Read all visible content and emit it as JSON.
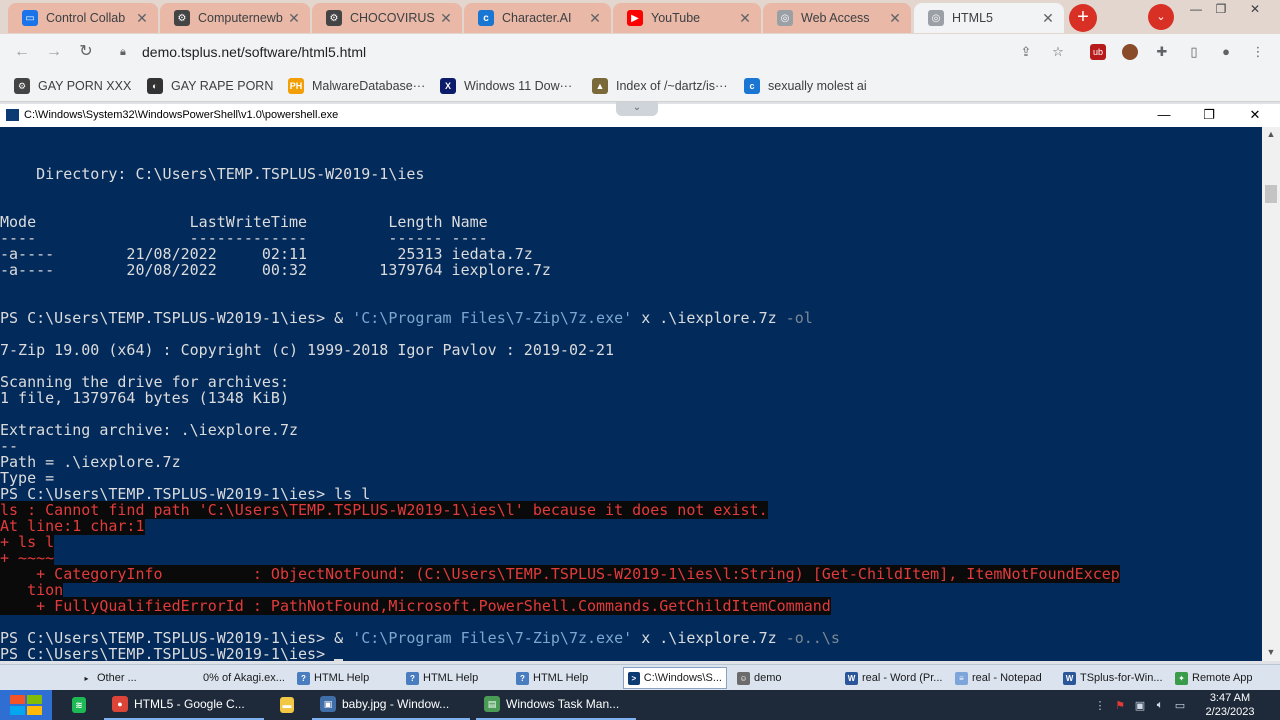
{
  "browser": {
    "tabs": [
      {
        "title": "Control Collab",
        "favicon": "monitor-icon",
        "color": "#1a73e8",
        "active": false
      },
      {
        "title": "Computernewb",
        "favicon": "gear-icon",
        "color": "#444444",
        "active": false
      },
      {
        "title": "CHOCOVIRUS",
        "favicon": "gear-icon",
        "color": "#444444",
        "active": false
      },
      {
        "title": "Character.AI",
        "favicon": "chat-icon",
        "color": "#1976d2",
        "active": false
      },
      {
        "title": "YouTube",
        "favicon": "play-icon",
        "color": "#ff0000",
        "active": false
      },
      {
        "title": "Web Access",
        "favicon": "globe-icon",
        "color": "#9aa0a6",
        "active": false
      },
      {
        "title": "HTML5",
        "favicon": "globe-icon",
        "color": "#9aa0a6",
        "active": true
      }
    ],
    "new_tab_label": "+",
    "tab_search_label": "⌄",
    "url": "demo.tsplus.net/software/html5.html",
    "bookmarks": [
      {
        "label": "GAY PORN XXX",
        "icon": "gear-icon",
        "color": "#444444",
        "glyph": "⚙"
      },
      {
        "label": "GAY RAPE PORN",
        "icon": "disc-icon",
        "color": "#333333",
        "glyph": "◐"
      },
      {
        "label": "MalwareDatabase···",
        "icon": "ph-icon",
        "color": "#f29f05",
        "glyph": "PH"
      },
      {
        "label": "Windows 11 Dow···",
        "icon": "x-icon",
        "color": "#0d1b6b",
        "glyph": "X"
      },
      {
        "label": "Index of /~dartz/is···",
        "icon": "folder-icon",
        "color": "#7a6a3a",
        "glyph": "▲"
      },
      {
        "label": "sexually molest ai",
        "icon": "chat-icon",
        "color": "#1976d2",
        "glyph": "c"
      }
    ]
  },
  "powershell": {
    "title": "C:\\Windows\\System32\\WindowsPowerShell\\v1.0\\powershell.exe",
    "lines": [
      [
        {
          "t": "    Directory: C:\\Users\\TEMP.TSPLUS-W2019-1\\ies"
        }
      ],
      [
        {
          "t": "Mode                 LastWriteTime         Length Name"
        }
      ],
      [
        {
          "t": "----                 -------------         ------ ----"
        }
      ],
      [
        {
          "t": "-a----        21/08/2022     02:11          25313 iedata.7z"
        }
      ],
      [
        {
          "t": "-a----        20/08/2022     00:32        1379764 iexplore.7z"
        }
      ],
      [
        {
          "t": "PS C:\\Users\\TEMP.TSPLUS-W2019-1\\ies> & "
        },
        {
          "t": "'C:\\Program Files\\7-Zip\\7z.exe'",
          "c": "str"
        },
        {
          "t": " x .\\iexplore.7z "
        },
        {
          "t": "-ol",
          "c": "param"
        }
      ],
      [
        {
          "t": "7-Zip 19.00 (x64) : Copyright (c) 1999-2018 Igor Pavlov : 2019-02-21"
        }
      ],
      [
        {
          "t": "Scanning the drive for archives:"
        }
      ],
      [
        {
          "t": "1 file, 1379764 bytes (1348 KiB)"
        }
      ],
      [
        {
          "t": "Extracting archive: .\\iexplore.7z"
        }
      ],
      [
        {
          "t": "--"
        }
      ],
      [
        {
          "t": "Path = .\\iexplore.7z"
        }
      ],
      [
        {
          "t": "Type = "
        }
      ],
      [
        {
          "t": "PS C:\\Users\\TEMP.TSPLUS-W2019-1\\ies> ls l"
        }
      ],
      [
        {
          "t": "ls : Cannot find path 'C:\\Users\\TEMP.TSPLUS-W2019-1\\ies\\l' because it does not exist.",
          "c": "err"
        }
      ],
      [
        {
          "t": "At line:1 char:1",
          "c": "err"
        }
      ],
      [
        {
          "t": "+ ls l",
          "c": "err"
        }
      ],
      [
        {
          "t": "+ ~~~~",
          "c": "err"
        }
      ],
      [
        {
          "t": "    + CategoryInfo          : ObjectNotFound: (C:\\Users\\TEMP.TSPLUS-W2019-1\\ies\\l:String) [Get-ChildItem], ItemNotFoundExcep",
          "c": "err"
        }
      ],
      [
        {
          "t": "   tion",
          "c": "err"
        }
      ],
      [
        {
          "t": "    + FullyQualifiedErrorId : PathNotFound,Microsoft.PowerShell.Commands.GetChildItemCommand",
          "c": "err"
        }
      ],
      [
        {
          "t": "PS C:\\Users\\TEMP.TSPLUS-W2019-1\\ies> & "
        },
        {
          "t": "'C:\\Program Files\\7-Zip\\7z.exe'",
          "c": "str"
        },
        {
          "t": " x .\\iexplore.7z "
        },
        {
          "t": "-o..\\s",
          "c": "param"
        }
      ],
      [
        {
          "t": "PS C:\\Users\\TEMP.TSPLUS-W2019-1\\ies> "
        },
        {
          "cursor": true
        }
      ]
    ]
  },
  "remote_taskbar": [
    {
      "label": "Other ...",
      "icon": "chevron-right-icon",
      "glyph": "▸",
      "color": "transparent"
    },
    {
      "label": "0% of Akagi.ex...",
      "icon": "none",
      "glyph": "",
      "color": "transparent"
    },
    {
      "label": "HTML Help",
      "icon": "help-icon",
      "glyph": "?",
      "color": "#4a7cc0"
    },
    {
      "label": "HTML Help",
      "icon": "help-icon",
      "glyph": "?",
      "color": "#4a7cc0"
    },
    {
      "label": "HTML Help",
      "icon": "help-icon",
      "glyph": "?",
      "color": "#4a7cc0"
    },
    {
      "label": "C:\\Windows\\S...",
      "icon": "powershell-icon",
      "glyph": ">",
      "color": "#0c3a72",
      "active": true
    },
    {
      "label": "demo",
      "icon": "user-icon",
      "glyph": "☺",
      "color": "#6b6b6b"
    },
    {
      "label": "real - Word (Pr...",
      "icon": "word-icon",
      "glyph": "W",
      "color": "#2b579a"
    },
    {
      "label": "real - Notepad",
      "icon": "notepad-icon",
      "glyph": "≡",
      "color": "#7ea5d9"
    },
    {
      "label": "TSplus-for-Win...",
      "icon": "word-icon",
      "glyph": "W",
      "color": "#2b579a"
    },
    {
      "label": "Remote App",
      "icon": "remote-app-icon",
      "glyph": "✦",
      "color": "#3a9b4b"
    }
  ],
  "taskbar": {
    "items": [
      {
        "label": "",
        "icon": "spotify-icon",
        "glyph": "≋",
        "color": "#1db954"
      },
      {
        "label": "HTML5 - Google C...",
        "icon": "chrome-icon",
        "glyph": "●",
        "color": "#db4437"
      },
      {
        "label": "",
        "icon": "file-explorer-icon",
        "glyph": "▬",
        "color": "#f2c744"
      },
      {
        "label": "baby.jpg - Window...",
        "icon": "photos-icon",
        "glyph": "▣",
        "color": "#3f6ea8"
      },
      {
        "label": "Windows Task Man...",
        "icon": "task-manager-icon",
        "glyph": "▤",
        "color": "#4a9b55"
      }
    ],
    "time": "3:47 AM",
    "date": "2/23/2023"
  }
}
